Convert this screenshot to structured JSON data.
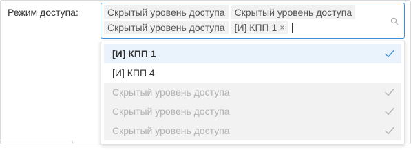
{
  "field": {
    "label": "Режим доступа:",
    "selected_tags": [
      {
        "label": "Скрытый уровень доступа",
        "removable": false
      },
      {
        "label": "Скрытый уровень доступа",
        "removable": false
      },
      {
        "label": "Скрытый уровень доступа",
        "removable": false
      },
      {
        "label": "[И] КПП 1",
        "removable": true,
        "remove_glyph": "×"
      }
    ],
    "search_icon": "search-icon",
    "accent_color": "#3d8fd6"
  },
  "dropdown": {
    "options": [
      {
        "label": "[И] КПП 1",
        "state": "active",
        "checked": true
      },
      {
        "label": "[И] КПП 4",
        "state": "normal",
        "checked": false
      },
      {
        "label": "Скрытый уровень доступа",
        "state": "disabled",
        "checked": true
      },
      {
        "label": "Скрытый уровень доступа",
        "state": "disabled",
        "checked": true
      },
      {
        "label": "Скрытый уровень доступа",
        "state": "disabled",
        "checked": true
      }
    ],
    "check_icon": "check-icon",
    "check_color_active": "#3d8fd6",
    "check_color_disabled": "#b3b3b3"
  }
}
